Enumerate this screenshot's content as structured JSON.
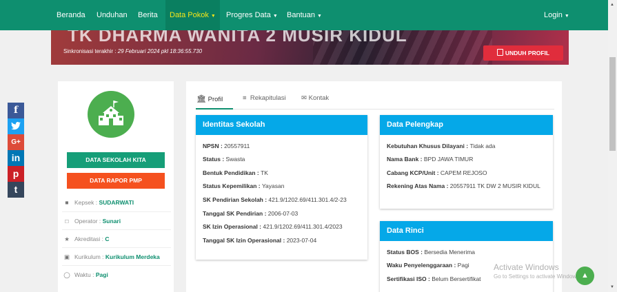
{
  "nav": {
    "items": [
      "Beranda",
      "Unduhan",
      "Berita",
      "Data Pokok",
      "Progres Data",
      "Bantuan"
    ],
    "login": "Login"
  },
  "hero": {
    "title": "TK DHARMA WANITA 2 MUSIR KIDUL",
    "sync_label": "Sinkronisasi terakhir : ",
    "sync_value": "29 Februari 2024 pkl 18:36:55.730",
    "download_button": "UNDUH PROFIL"
  },
  "social": [
    "f",
    "t",
    "G+",
    "in",
    "p",
    "t"
  ],
  "sidebar": {
    "btn_data_sekolah": "DATA SEKOLAH KITA",
    "btn_rapor": "DATA RAPOR PMP",
    "info": [
      {
        "label": "Kepsek : ",
        "value": "SUDARWATI"
      },
      {
        "label": "Operator : ",
        "value": "Sunari"
      },
      {
        "label": "Akreditasi : ",
        "value": "C"
      },
      {
        "label": "Kurikulum : ",
        "value": "Kurikulum Merdeka"
      },
      {
        "label": "Waktu : ",
        "value": "Pagi"
      }
    ]
  },
  "tabs": [
    "Profil",
    "Rekapitulasi",
    "Kontak"
  ],
  "identitas": {
    "title": "Identitas Sekolah",
    "fields": [
      {
        "label": "NPSN : ",
        "value": "20557911"
      },
      {
        "label": "Status : ",
        "value": "Swasta"
      },
      {
        "label": "Bentuk Pendidikan : ",
        "value": "TK"
      },
      {
        "label": "Status Kepemilikan : ",
        "value": "Yayasan"
      },
      {
        "label": "SK Pendirian Sekolah : ",
        "value": "421.9/1202.69/411.301.4/2-23"
      },
      {
        "label": "Tanggal SK Pendirian : ",
        "value": "2006-07-03"
      },
      {
        "label": "SK Izin Operasional : ",
        "value": "421.9/1202.69/411.301.4/2023"
      },
      {
        "label": "Tanggal SK Izin Operasional : ",
        "value": "2023-07-04"
      }
    ]
  },
  "pelengkap": {
    "title": "Data Pelengkap",
    "fields": [
      {
        "label": "Kebutuhan Khusus Dilayani : ",
        "value": "Tidak ada"
      },
      {
        "label": "Nama Bank : ",
        "value": "BPD JAWA TIMUR"
      },
      {
        "label": "Cabang KCP/Unit : ",
        "value": "CAPEM REJOSO"
      },
      {
        "label": "Rekening Atas Nama : ",
        "value": "20557911 TK DW 2 MUSIR KIDUL"
      }
    ]
  },
  "rinci": {
    "title": "Data Rinci",
    "fields": [
      {
        "label": "Status BOS : ",
        "value": "Bersedia Menerima"
      },
      {
        "label": "Waku Penyelenggaraan : ",
        "value": "Pagi"
      },
      {
        "label": "Sertifikasi ISO : ",
        "value": "Belum Bersertifikat"
      }
    ]
  },
  "watermark": {
    "line1": "Activate Windows",
    "line2": "Go to Settings to activate Windows."
  },
  "colors": {
    "navbar": "#0e8f6f",
    "panel_header": "#05a8e8",
    "btn_green": "#169e78",
    "btn_orange": "#f5511f",
    "btn_red": "#e02d3c"
  }
}
